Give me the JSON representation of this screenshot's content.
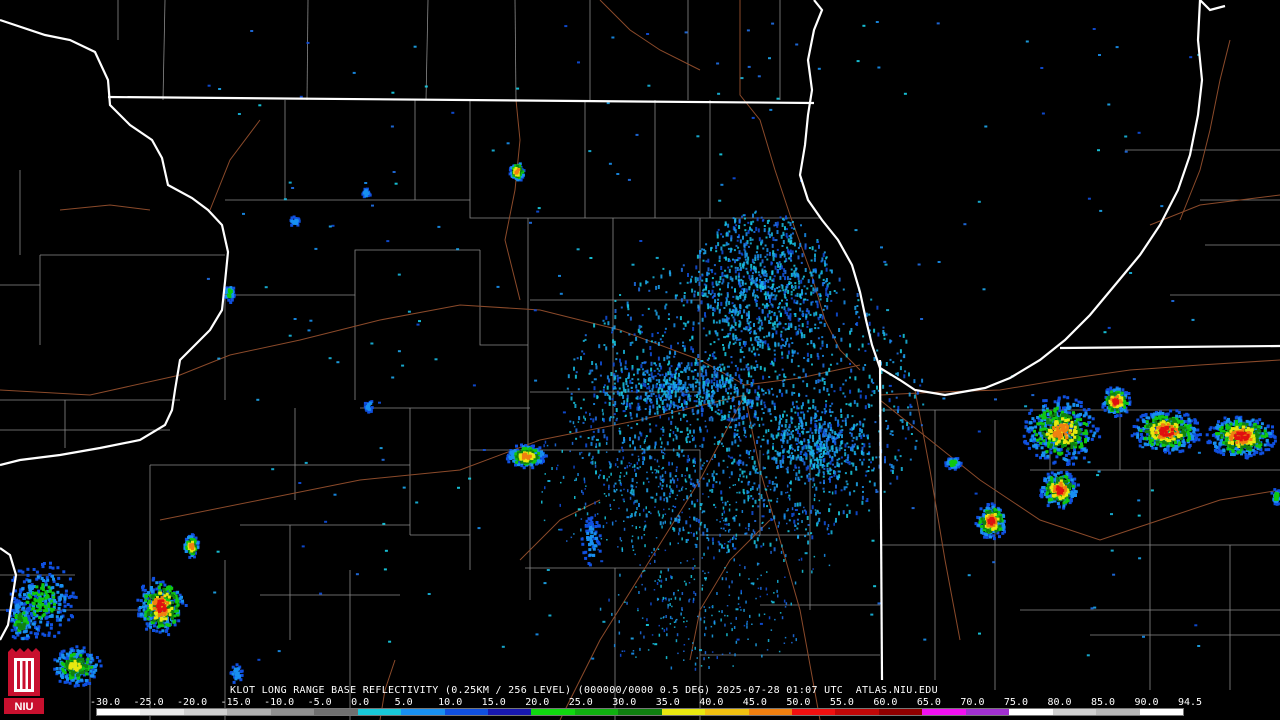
{
  "product": {
    "caption": "KLOT LONG RANGE BASE REFLECTIVITY (0.25KM / 256 LEVEL) (000000/0000 0.5 DEG) 2025-07-28 01:07 UTC  ATLAS.NIU.EDU",
    "logo_text": "NIU"
  },
  "colorbar": {
    "ticks": [
      "-30.0",
      "-25.0",
      "-20.0",
      "-15.0",
      "-10.0",
      "-5.0",
      "0.0",
      "5.0",
      "10.0",
      "15.0",
      "20.0",
      "25.0",
      "30.0",
      "35.0",
      "40.0",
      "45.0",
      "50.0",
      "55.0",
      "60.0",
      "65.0",
      "70.0",
      "75.0",
      "80.0",
      "85.0",
      "90.0",
      "94.5"
    ],
    "colors": [
      "#ffffff",
      "#e8e8e8",
      "#cfcfcf",
      "#b0b0b0",
      "#909090",
      "#707070",
      "#18c8d8",
      "#1890f0",
      "#1050e0",
      "#1818b0",
      "#10d810",
      "#10b010",
      "#108010",
      "#e8e810",
      "#f0c010",
      "#f08010",
      "#f01010",
      "#c00808",
      "#900000",
      "#f010f0",
      "#a030d0",
      "#ffffff",
      "#d0d0d0",
      "#b8b8b8",
      "#ffffff"
    ],
    "colors_note": "reflectivity palette"
  },
  "map": {
    "state_boundary_color": "#ffffff",
    "county_line_color": "#8a8a8a",
    "road_color": "#8b4a2a",
    "radar_site": "KLOT"
  }
}
